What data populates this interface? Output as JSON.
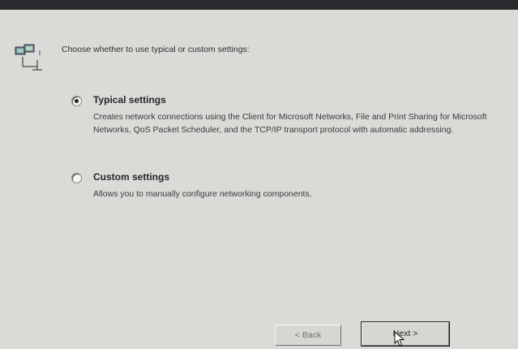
{
  "header": {
    "prompt": "Choose whether to use typical or custom settings:",
    "icon": "network-icon"
  },
  "options": [
    {
      "title": "Typical settings",
      "selected": true,
      "description": "Creates network connections using the Client for Microsoft Networks, File and Print Sharing for Microsoft Networks, QoS Packet Scheduler, and the TCP/IP transport protocol with automatic addressing."
    },
    {
      "title": "Custom settings",
      "selected": false,
      "description": "Allows you to manually configure networking components."
    }
  ],
  "buttons": {
    "back": "< Back",
    "next": "Next >"
  }
}
